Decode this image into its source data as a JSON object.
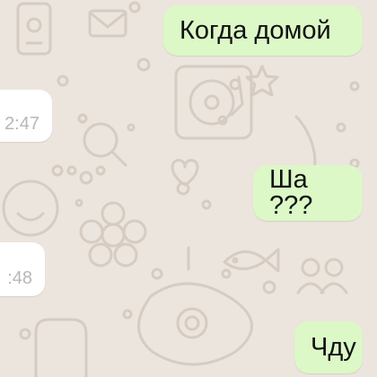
{
  "messages": [
    {
      "direction": "outgoing",
      "text": "Когда домой"
    },
    {
      "direction": "incoming",
      "time": "2:47"
    },
    {
      "direction": "outgoing",
      "text": "Ша ???"
    },
    {
      "direction": "incoming",
      "time": ":48"
    },
    {
      "direction": "outgoing",
      "text": "Чду"
    }
  ],
  "colors": {
    "wallpaper": "#ece5dd",
    "outgoing_bubble": "#dcf8c6",
    "incoming_bubble": "#ffffff",
    "timestamp": "#b7b7b7"
  },
  "wallpaper_pattern": "doodle-icons"
}
